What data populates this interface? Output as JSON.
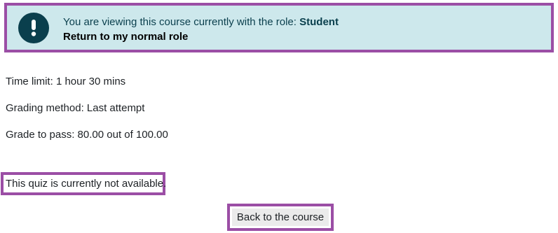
{
  "role_alert": {
    "icon": "exclamation-icon",
    "message_prefix": "You are viewing this course currently with the role: ",
    "role_name": "Student",
    "return_link": "Return to my normal role",
    "colors": {
      "background": "#cde8ec",
      "icon_circle": "#0a3f4d",
      "text": "#0a3f4d"
    }
  },
  "quiz_info": {
    "time_limit": "Time limit: 1 hour 30 mins",
    "grading_method": "Grading method: Last attempt",
    "grade_to_pass": "Grade to pass: 80.00 out of 100.00"
  },
  "availability_notice": "This quiz is currently not available.",
  "back_button_label": "Back to the course",
  "highlight_color": "#9b4ea5"
}
